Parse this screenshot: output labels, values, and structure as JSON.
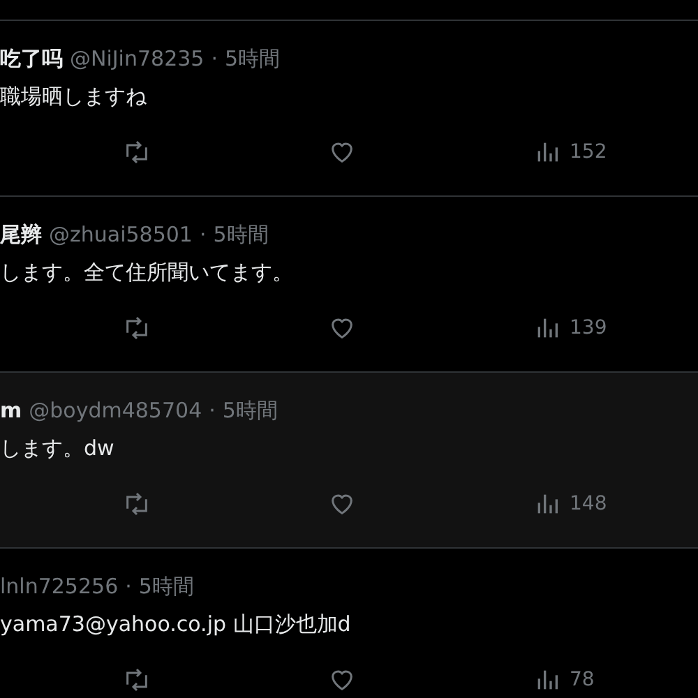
{
  "replies": [
    {
      "name": "吃了吗",
      "handle": "@NiJin78235",
      "separator": "·",
      "time": "5時間",
      "text": "職場晒しますね",
      "views": "152",
      "highlighted": false
    },
    {
      "name": "尾辫",
      "handle": "@zhuai58501",
      "separator": "·",
      "time": "5時間",
      "text": "します。全て住所聞いてます。",
      "views": "139",
      "highlighted": false
    },
    {
      "name": "m",
      "handle": "@boydm485704",
      "separator": "·",
      "time": "5時間",
      "text": "します。dw",
      "views": "148",
      "highlighted": true
    },
    {
      "handle": "lnln725256",
      "separator": "·",
      "time": "5時間",
      "text": "yama73@yahoo.co.jp 山口沙也加d",
      "views": "78",
      "highlighted": false
    }
  ]
}
